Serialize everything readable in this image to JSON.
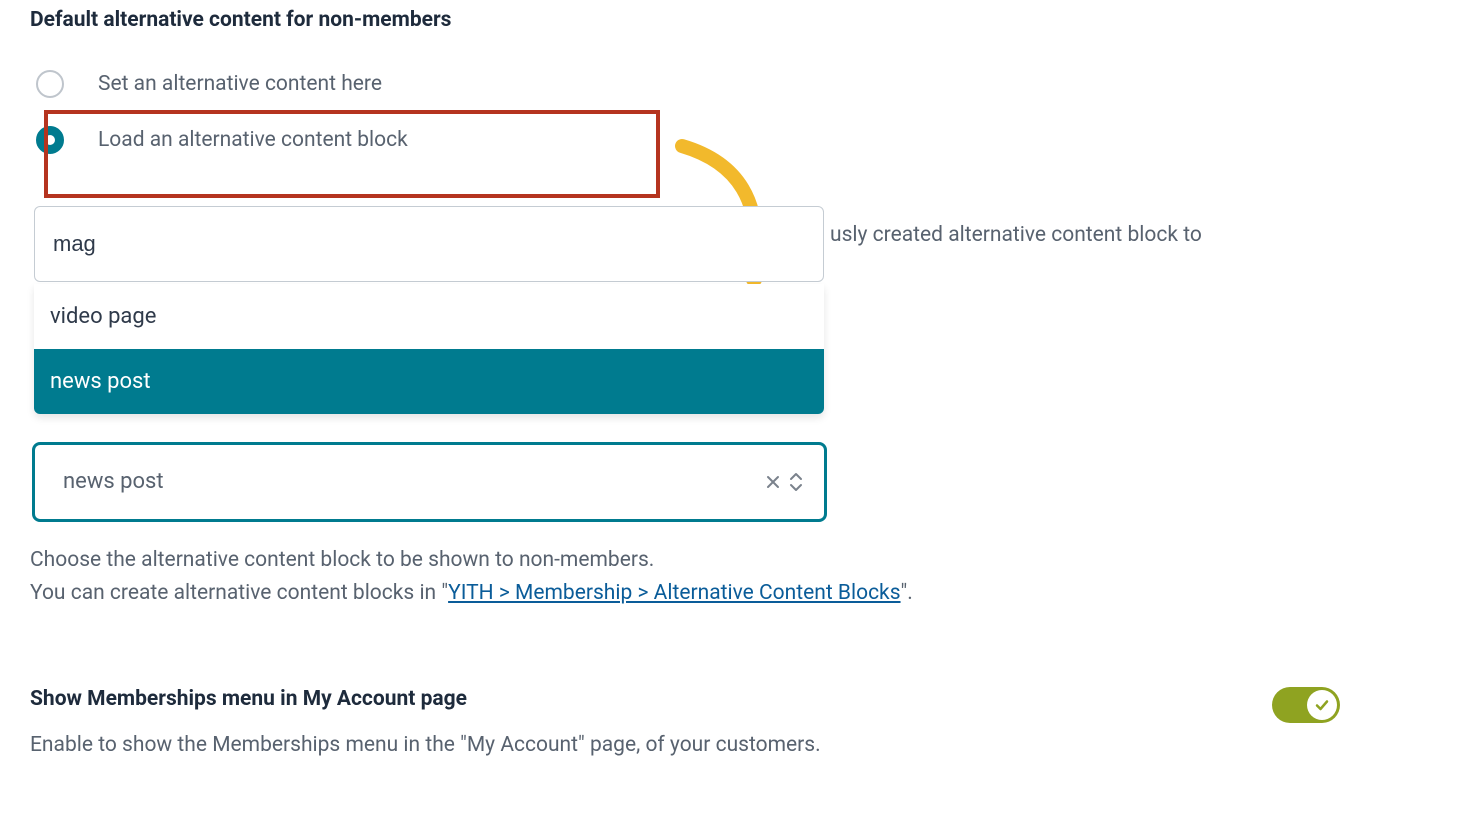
{
  "section": {
    "title": "Default alternative content for non-members",
    "radio_options": [
      {
        "label": "Set an alternative content here",
        "selected": false
      },
      {
        "label": "Load an alternative content block",
        "selected": true
      }
    ]
  },
  "search": {
    "value": "mag",
    "dropdown_items": [
      {
        "label": "video page",
        "highlighted": false
      },
      {
        "label": "news post",
        "highlighted": true
      }
    ]
  },
  "description_partial": "usly created alternative content block to",
  "selected_block": {
    "value": "news post"
  },
  "help": {
    "line1": "Choose the alternative content block to be shown to non-members.",
    "line2_prefix": "You can create alternative content blocks in \"",
    "line2_link": "YITH > Membership > Alternative Content Blocks",
    "line2_suffix": "\"."
  },
  "menu_setting": {
    "title": "Show Memberships menu in My Account page",
    "description": "Enable to show the Memberships menu in the \"My Account\" page, of your customers.",
    "toggle_on": true
  }
}
